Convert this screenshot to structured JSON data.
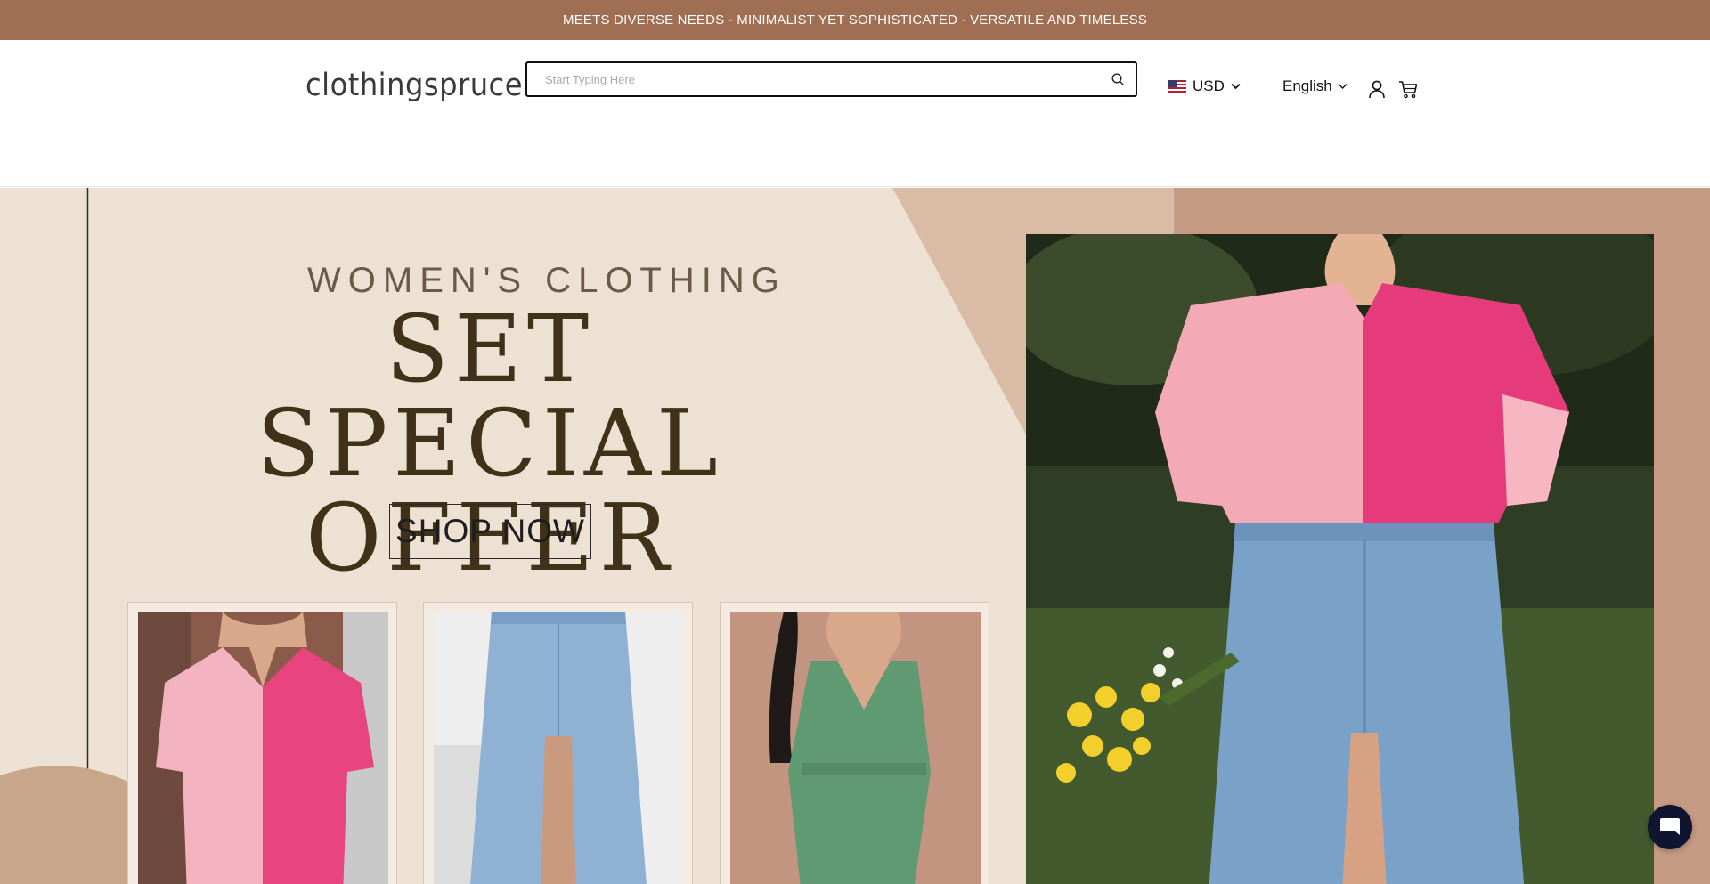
{
  "announcement": {
    "text": "MEETS DIVERSE NEEDS - MINIMALIST YET SOPHISTICATED - VERSATILE AND TIMELESS"
  },
  "header": {
    "logo_text": "clothingspruce",
    "search": {
      "placeholder": "Start Typing Here",
      "value": ""
    },
    "currency": {
      "label": "USD",
      "flag_icon": "us-flag-icon"
    },
    "language": {
      "label": "English"
    },
    "icons": [
      "search-icon",
      "account-icon",
      "cart-icon",
      "chevron-down-icon"
    ]
  },
  "hero": {
    "kicker": "WOMEN'S CLOTHING",
    "headline_line1": "SET SPECIAL",
    "headline_line2": "OFFER",
    "cta_label": "SHOP NOW",
    "colors": {
      "cream": "#ede1d3",
      "tan": "#d5b49d",
      "rose_brown": "#c49a82",
      "headline": "#3f3219"
    },
    "products": [
      {
        "description": "pink colorblock waffle top"
      },
      {
        "description": "denim button slit skirt"
      },
      {
        "description": "green polka dot romper"
      }
    ]
  },
  "chat": {
    "icon": "chat-bubble-icon"
  }
}
